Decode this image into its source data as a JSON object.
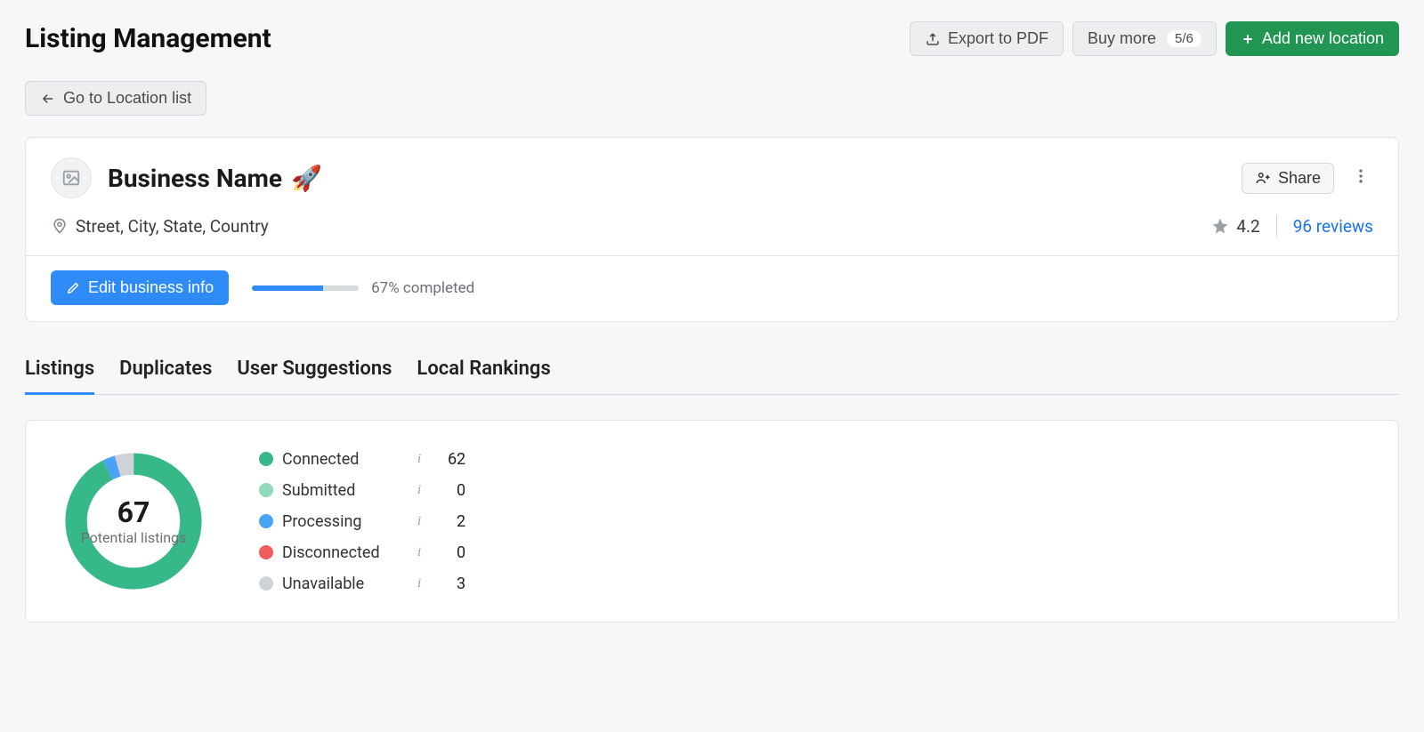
{
  "header": {
    "title": "Listing Management",
    "export_label": "Export to PDF",
    "buymore_label": "Buy more",
    "buymore_badge": "5/6",
    "addnew_label": "Add new location",
    "goback_label": "Go to Location list"
  },
  "business": {
    "name": "Business Name",
    "emoji": "🚀",
    "address": "Street, City, State, Country",
    "rating": "4.2",
    "reviews_text": "96 reviews",
    "edit_button": "Edit business info",
    "progress_percent": 67,
    "progress_text": "67% completed",
    "share_label": "Share"
  },
  "tabs": [
    {
      "label": "Listings",
      "active": true
    },
    {
      "label": "Duplicates",
      "active": false
    },
    {
      "label": "User Suggestions",
      "active": false
    },
    {
      "label": "Local Rankings",
      "active": false
    }
  ],
  "stats": {
    "total": 67,
    "total_label": "Potential listings",
    "items": [
      {
        "label": "Connected",
        "value": 62,
        "color": "#36b889"
      },
      {
        "label": "Submitted",
        "value": 0,
        "color": "#8fdab9"
      },
      {
        "label": "Processing",
        "value": 2,
        "color": "#4aa3f2"
      },
      {
        "label": "Disconnected",
        "value": 0,
        "color": "#f15b5b"
      },
      {
        "label": "Unavailable",
        "value": 3,
        "color": "#cfd3d7"
      }
    ]
  },
  "chart_data": {
    "type": "pie",
    "title": "Potential listings",
    "categories": [
      "Connected",
      "Submitted",
      "Processing",
      "Disconnected",
      "Unavailable"
    ],
    "values": [
      62,
      0,
      2,
      0,
      3
    ],
    "total": 67,
    "colors": [
      "#36b889",
      "#8fdab9",
      "#4aa3f2",
      "#f15b5b",
      "#cfd3d7"
    ]
  }
}
